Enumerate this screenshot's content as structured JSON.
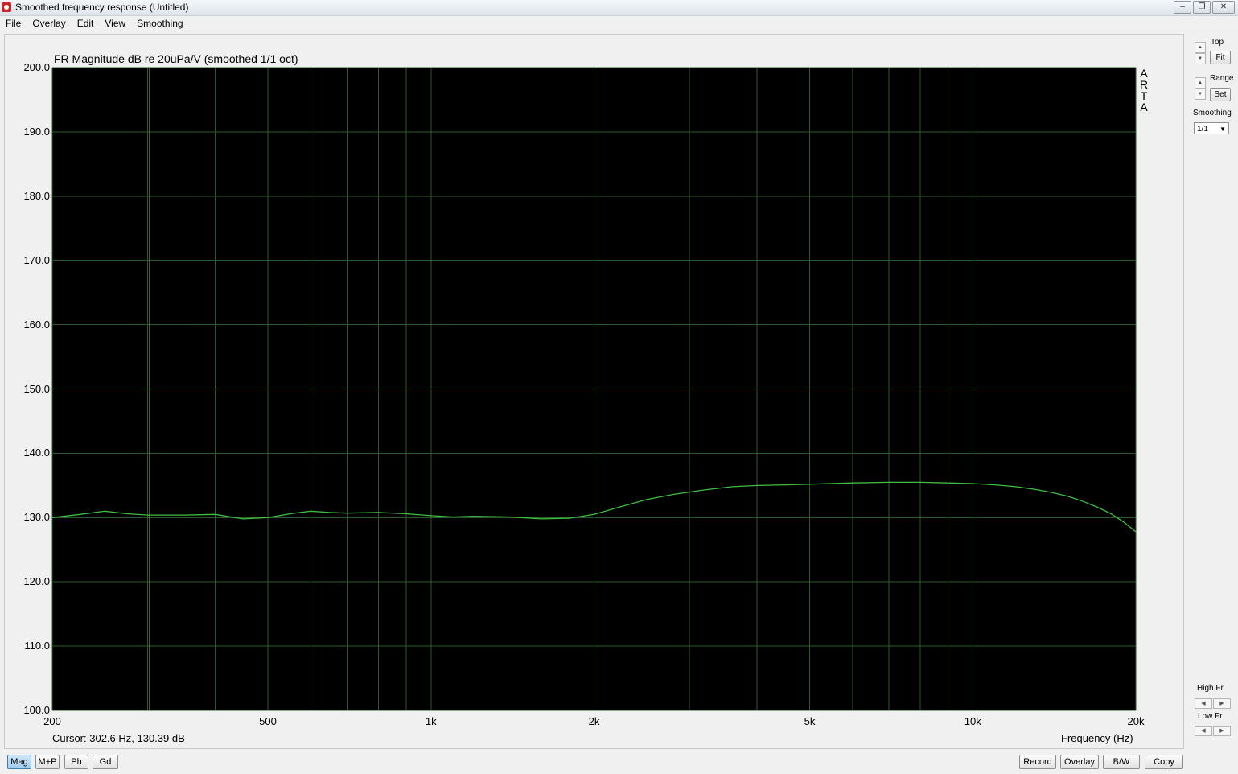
{
  "window": {
    "title": "Smoothed frequency response (Untitled)"
  },
  "menu": [
    "File",
    "Overlay",
    "Edit",
    "View",
    "Smoothing"
  ],
  "chart_data": {
    "type": "line",
    "title": "FR Magnitude dB re 20uPa/V (smoothed 1/1 oct)",
    "xlabel": "Frequency (Hz)",
    "ylabel": "",
    "x_scale": "log",
    "xlim": [
      200,
      20000
    ],
    "ylim": [
      100,
      200
    ],
    "x_ticks": [
      {
        "value": 200,
        "label": "200"
      },
      {
        "value": 500,
        "label": "500"
      },
      {
        "value": 1000,
        "label": "1k"
      },
      {
        "value": 2000,
        "label": "2k"
      },
      {
        "value": 5000,
        "label": "5k"
      },
      {
        "value": 10000,
        "label": "10k"
      },
      {
        "value": 20000,
        "label": "20k"
      }
    ],
    "y_ticks": [
      "200.0",
      "190.0",
      "180.0",
      "170.0",
      "160.0",
      "150.0",
      "140.0",
      "130.0",
      "120.0",
      "110.0",
      "100.0"
    ],
    "grid": true,
    "background": "#000000",
    "grid_color": "#2d5a2d",
    "cursor_x": 302.6,
    "series": [
      {
        "color": "#3fbf3f",
        "x": [
          200,
          225,
          250,
          275,
          300,
          350,
          400,
          450,
          500,
          550,
          600,
          650,
          700,
          800,
          900,
          1000,
          1100,
          1200,
          1400,
          1600,
          1800,
          2000,
          2200,
          2500,
          2800,
          3200,
          3600,
          4000,
          4500,
          5000,
          6000,
          7000,
          8000,
          9000,
          10000,
          11000,
          12000,
          13000,
          14000,
          15000,
          16000,
          17000,
          18000,
          19000,
          20000
        ],
        "y": [
          130.0,
          130.5,
          131.0,
          130.6,
          130.4,
          130.4,
          130.5,
          129.8,
          130.0,
          130.6,
          131.0,
          130.8,
          130.7,
          130.8,
          130.6,
          130.3,
          130.1,
          130.2,
          130.1,
          129.8,
          129.9,
          130.5,
          131.5,
          132.8,
          133.6,
          134.3,
          134.8,
          135.0,
          135.1,
          135.2,
          135.4,
          135.5,
          135.5,
          135.4,
          135.3,
          135.1,
          134.8,
          134.4,
          133.9,
          133.3,
          132.5,
          131.6,
          130.6,
          129.3,
          127.8
        ]
      }
    ]
  },
  "status": {
    "cursor": "Cursor: 302.6 Hz, 130.39 dB"
  },
  "side_panel": {
    "top_label": "Top",
    "fit_button": "Fit",
    "range_label": "Range",
    "set_button": "Set",
    "smoothing_label": "Smoothing",
    "smoothing_value": "1/1",
    "high_fr_label": "High Fr",
    "low_fr_label": "Low Fr"
  },
  "brand": [
    "A",
    "R",
    "T",
    "A"
  ],
  "bottom_left_buttons": [
    "Mag",
    "M+P",
    "Ph",
    "Gd"
  ],
  "bottom_right_buttons": [
    "Record",
    "Overlay",
    "B/W",
    "Copy"
  ]
}
